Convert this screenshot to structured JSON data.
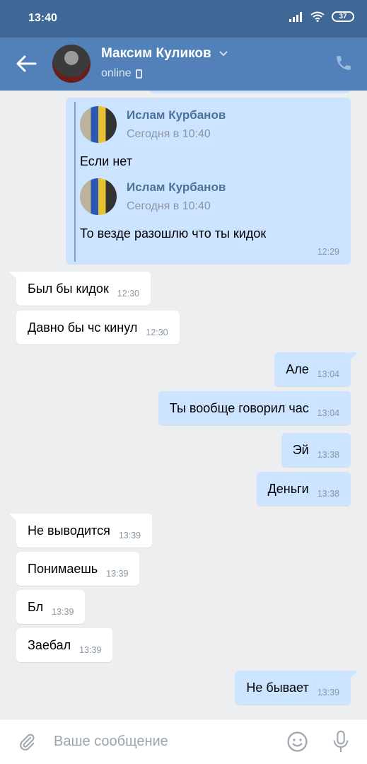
{
  "status_bar": {
    "time": "13:40",
    "battery": "37"
  },
  "header": {
    "name": "Максим Куликов",
    "status": "online"
  },
  "forwarded": {
    "items": [
      {
        "author": "Ислам Курбанов",
        "date": "Сегодня в 10:40",
        "text": "Если нет"
      },
      {
        "author": "Ислам Курбанов",
        "date": "Сегодня в 10:40",
        "text": "То везде разошлю что ты кидок"
      }
    ],
    "time": "12:29"
  },
  "messages": [
    {
      "text": "Был бы кидок",
      "time": "12:30",
      "dir": "in"
    },
    {
      "text": "Давно бы чс кинул",
      "time": "12:30",
      "dir": "in"
    },
    {
      "text": "Але",
      "time": "13:04",
      "dir": "out"
    },
    {
      "text": "Ты вообще говорил час",
      "time": "13:04",
      "dir": "out"
    },
    {
      "text": "Эй",
      "time": "13:38",
      "dir": "out"
    },
    {
      "text": "Деньги",
      "time": "13:38",
      "dir": "out"
    },
    {
      "text": "Не выводится",
      "time": "13:39",
      "dir": "in"
    },
    {
      "text": "Понимаешь",
      "time": "13:39",
      "dir": "in"
    },
    {
      "text": "Бл",
      "time": "13:39",
      "dir": "in"
    },
    {
      "text": "Заебал",
      "time": "13:39",
      "dir": "in"
    },
    {
      "text": "Не бывает",
      "time": "13:39",
      "dir": "out"
    }
  ],
  "composer": {
    "placeholder": "Ваше сообщение"
  },
  "icons": {
    "back": "arrow-left-icon",
    "call": "phone-icon",
    "attach": "paperclip-icon",
    "emoji": "smile-icon",
    "voice": "microphone-icon",
    "signal": "signal-icon",
    "wifi": "wifi-icon"
  },
  "colors": {
    "header": "#5181b8",
    "statusbar": "#3f6896",
    "outgoing": "#cce4ff",
    "incoming": "#ffffff",
    "background": "#edeef0"
  }
}
